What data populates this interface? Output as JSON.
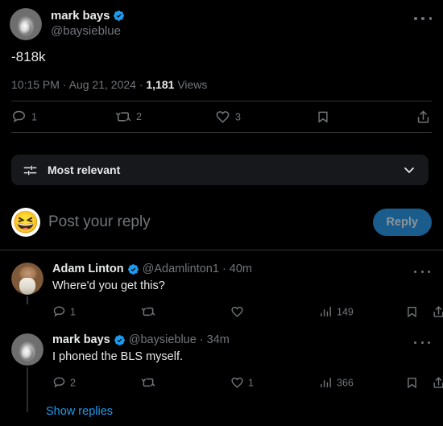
{
  "colors": {
    "background": "#000000",
    "text_primary": "#e7e9ea",
    "text_muted": "#71767b",
    "accent_blue": "#1d9bf0",
    "verified_blue": "#1d9bf0",
    "reply_button_bg": "#1a5c8c",
    "sortbar_bg": "#16181c",
    "divider": "#2f3336"
  },
  "main_tweet": {
    "author": {
      "display_name": "mark bays",
      "handle": "@baysieblue",
      "verified": true,
      "avatar_icon": "statue-portrait-avatar"
    },
    "more_menu_icon": "more-horizontal-icon",
    "text": "-818k",
    "timestamp": {
      "time": "10:15 PM",
      "sep1": "·",
      "date": "Aug 21, 2024",
      "sep2": "·",
      "views_count": "1,181",
      "views_label": "Views"
    },
    "actions": [
      {
        "name": "reply",
        "icon": "comment-icon",
        "count": "1"
      },
      {
        "name": "retweet",
        "icon": "retweet-icon",
        "count": "2"
      },
      {
        "name": "like",
        "icon": "heart-icon",
        "count": "3"
      },
      {
        "name": "bookmark",
        "icon": "bookmark-icon",
        "count": ""
      },
      {
        "name": "share",
        "icon": "share-icon",
        "count": ""
      }
    ]
  },
  "sort_bar": {
    "icon": "sliders-icon",
    "label": "Most relevant",
    "chevron_icon": "chevron-down-icon"
  },
  "composer": {
    "avatar_emoji": "😆",
    "avatar_icon": "laughing-emoji-avatar",
    "placeholder": "Post your reply",
    "reply_button_label": "Reply"
  },
  "replies": [
    {
      "author": {
        "display_name": "Adam Linton",
        "handle": "@Adamlinton1",
        "verified": true,
        "avatar_icon": "photo-portrait-avatar"
      },
      "separator": "·",
      "time_ago": "40m",
      "more_menu_icon": "more-horizontal-icon",
      "text": "Where'd you get this?",
      "actions": [
        {
          "name": "reply",
          "icon": "comment-icon",
          "count": "1"
        },
        {
          "name": "retweet",
          "icon": "retweet-icon",
          "count": ""
        },
        {
          "name": "like",
          "icon": "heart-icon",
          "count": ""
        },
        {
          "name": "views",
          "icon": "analytics-icon",
          "count": "149"
        },
        {
          "name": "bookmark",
          "icon": "bookmark-icon",
          "count": ""
        },
        {
          "name": "share",
          "icon": "share-icon",
          "count": ""
        }
      ]
    },
    {
      "author": {
        "display_name": "mark bays",
        "handle": "@baysieblue",
        "verified": true,
        "avatar_icon": "statue-portrait-avatar"
      },
      "separator": "·",
      "time_ago": "34m",
      "more_menu_icon": "more-horizontal-icon",
      "text": "I phoned the BLS myself.",
      "actions": [
        {
          "name": "reply",
          "icon": "comment-icon",
          "count": "2"
        },
        {
          "name": "retweet",
          "icon": "retweet-icon",
          "count": ""
        },
        {
          "name": "like",
          "icon": "heart-icon",
          "count": "1"
        },
        {
          "name": "views",
          "icon": "analytics-icon",
          "count": "366"
        },
        {
          "name": "bookmark",
          "icon": "bookmark-icon",
          "count": ""
        },
        {
          "name": "share",
          "icon": "share-icon",
          "count": ""
        }
      ]
    }
  ],
  "show_replies_link": "Show replies"
}
